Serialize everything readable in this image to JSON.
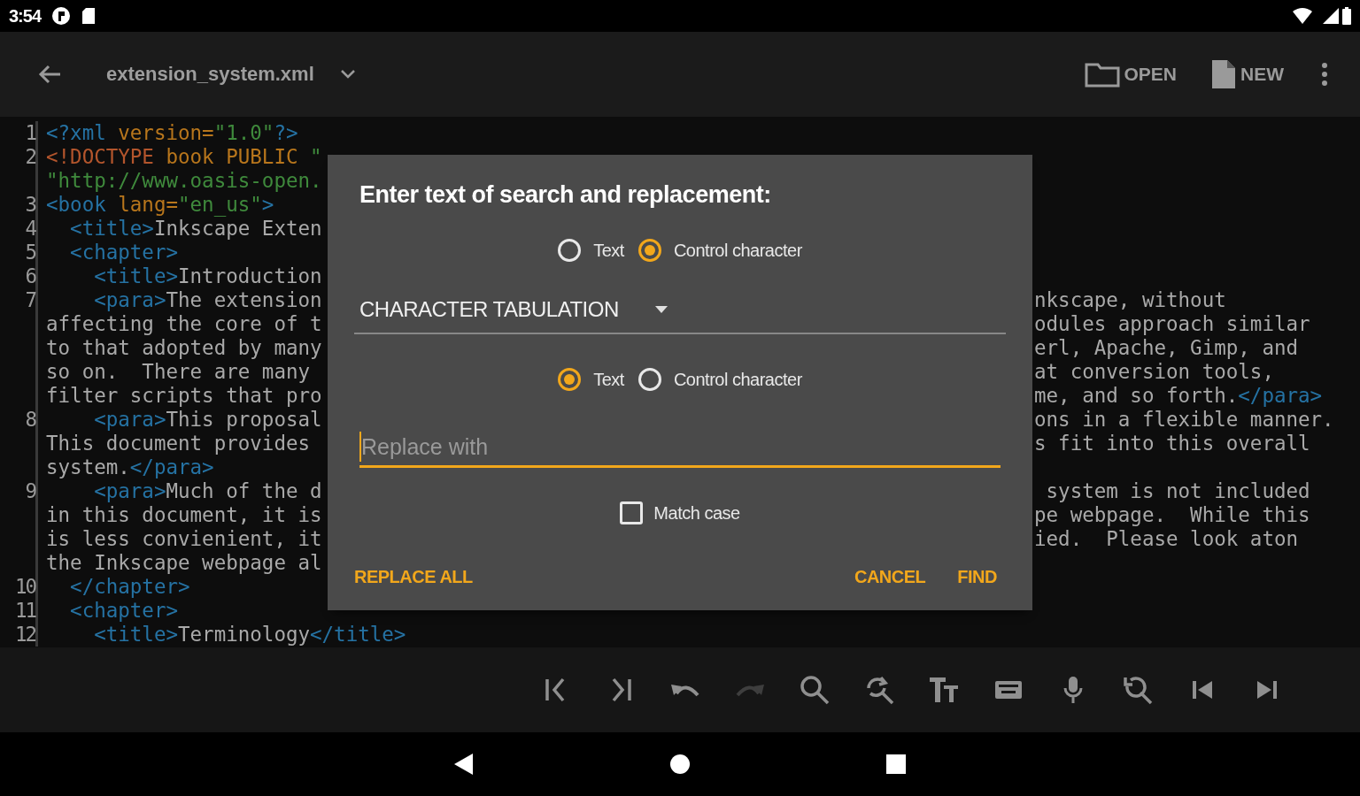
{
  "status_bar": {
    "time": "3:54"
  },
  "app_bar": {
    "file_name": "extension_system.xml",
    "actions": [
      {
        "kind": "folder",
        "label": "OPEN"
      },
      {
        "kind": "file",
        "label": "NEW"
      }
    ]
  },
  "editor": {
    "rows": [
      {
        "number": "1",
        "left": [
          {
            "kind": "tag",
            "text": "<?xml"
          },
          {
            "kind": "attr",
            "text": " version="
          },
          {
            "kind": "string",
            "text": "\"1.0\""
          },
          {
            "kind": "tag",
            "text": "?>"
          }
        ]
      },
      {
        "number": "2",
        "left": [
          {
            "kind": "doctype",
            "text": "<!DOCTYPE"
          },
          {
            "kind": "attr",
            "text": " book PUBLIC "
          },
          {
            "kind": "string",
            "text": "\""
          }
        ]
      },
      {
        "left": [
          {
            "kind": "string",
            "text": "\"http://www.oasis-open."
          }
        ]
      },
      {
        "number": "3",
        "left": [
          {
            "kind": "tag",
            "text": "<book"
          },
          {
            "kind": "attr",
            "text": " lang="
          },
          {
            "kind": "string",
            "text": "\"en_us\""
          },
          {
            "kind": "tag",
            "text": ">"
          }
        ]
      },
      {
        "number": "4",
        "left": [
          {
            "kind": "tag",
            "text": "  <title>"
          },
          {
            "kind": "text",
            "text": "Inkscape Exten"
          }
        ]
      },
      {
        "number": "5",
        "left": [
          {
            "kind": "tag",
            "text": "  <chapter>"
          }
        ]
      },
      {
        "number": "6",
        "left": [
          {
            "kind": "tag",
            "text": "    <title>"
          },
          {
            "kind": "text",
            "text": "Introduction"
          }
        ]
      },
      {
        "number": "7",
        "left": [
          {
            "kind": "tag",
            "text": "    <para>"
          },
          {
            "kind": "text",
            "text": "The extension"
          }
        ],
        "right": [
          {
            "kind": "text",
            "text": "nkscape, without"
          }
        ]
      },
      {
        "left": [
          {
            "kind": "text",
            "text": "affecting the core of t"
          }
        ],
        "right": [
          {
            "kind": "text",
            "text": "odules approach similar"
          }
        ]
      },
      {
        "left": [
          {
            "kind": "text",
            "text": "to that adopted by many"
          }
        ],
        "right": [
          {
            "kind": "text",
            "text": "erl, Apache, Gimp, and"
          }
        ]
      },
      {
        "left": [
          {
            "kind": "text",
            "text": "so on.  There are many"
          }
        ],
        "right": [
          {
            "kind": "text",
            "text": "at conversion tools,"
          }
        ]
      },
      {
        "left": [
          {
            "kind": "text",
            "text": "filter scripts that pro"
          }
        ],
        "right": [
          {
            "kind": "text",
            "text": "me, and so forth."
          },
          {
            "kind": "tag",
            "text": "</para>"
          }
        ]
      },
      {
        "number": "8",
        "left": [
          {
            "kind": "tag",
            "text": "    <para>"
          },
          {
            "kind": "text",
            "text": "This proposal"
          }
        ],
        "right": [
          {
            "kind": "text",
            "text": "ons in a flexible manner."
          }
        ]
      },
      {
        "left": [
          {
            "kind": "text",
            "text": "This document provides"
          }
        ],
        "right": [
          {
            "kind": "text",
            "text": "s fit into this overall"
          }
        ]
      },
      {
        "left": [
          {
            "kind": "text",
            "text": "system."
          },
          {
            "kind": "tag",
            "text": "</para>"
          }
        ]
      },
      {
        "number": "9",
        "left": [
          {
            "kind": "tag",
            "text": "    <para>"
          },
          {
            "kind": "text",
            "text": "Much of the d"
          }
        ],
        "right": [
          {
            "kind": "text",
            "text": " system is not included"
          }
        ]
      },
      {
        "left": [
          {
            "kind": "text",
            "text": "in this document, it is"
          }
        ],
        "right": [
          {
            "kind": "text",
            "text": "pe webpage.  While this"
          }
        ]
      },
      {
        "left": [
          {
            "kind": "text",
            "text": "is less convienient, it"
          }
        ],
        "right": [
          {
            "kind": "text",
            "text": "ied.  Please look aton"
          }
        ]
      },
      {
        "left": [
          {
            "kind": "text",
            "text": "the Inkscape webpage al"
          }
        ]
      },
      {
        "number": "10",
        "left": [
          {
            "kind": "tag",
            "text": "  </chapter>"
          }
        ]
      },
      {
        "number": "11",
        "left": [
          {
            "kind": "tag",
            "text": "  <chapter>"
          }
        ]
      },
      {
        "number": "12",
        "left": [
          {
            "kind": "tag",
            "text": "    <title>"
          },
          {
            "kind": "text",
            "text": "Terminology"
          },
          {
            "kind": "tag",
            "text": "</title>"
          }
        ]
      }
    ]
  },
  "dialog": {
    "title": "Enter text of search and replacement:",
    "search_mode": [
      {
        "label": "Text",
        "selected": false
      },
      {
        "label": "Control character",
        "selected": true
      }
    ],
    "character_dropdown": {
      "value": "CHARACTER TABULATION"
    },
    "replace_mode": [
      {
        "label": "Text",
        "selected": true
      },
      {
        "label": "Control character",
        "selected": false
      }
    ],
    "replace_field": {
      "placeholder": "Replace with",
      "focused": true
    },
    "match_case": {
      "label": "Match case",
      "checked": false
    },
    "buttons": {
      "left": "REPLACE ALL",
      "right": [
        "CANCEL",
        "FIND"
      ]
    }
  },
  "bottom_toolbar": [
    {
      "kind": "go-start",
      "disabled": false
    },
    {
      "kind": "go-end",
      "disabled": false
    },
    {
      "kind": "undo",
      "disabled": false
    },
    {
      "kind": "redo",
      "disabled": true
    },
    {
      "kind": "search",
      "disabled": false
    },
    {
      "kind": "replace",
      "disabled": false
    },
    {
      "kind": "text-size",
      "disabled": false
    },
    {
      "kind": "keyboard",
      "disabled": false
    },
    {
      "kind": "microphone",
      "disabled": false
    },
    {
      "kind": "search-back",
      "disabled": false
    },
    {
      "kind": "first",
      "disabled": false
    },
    {
      "kind": "last",
      "disabled": false
    }
  ]
}
